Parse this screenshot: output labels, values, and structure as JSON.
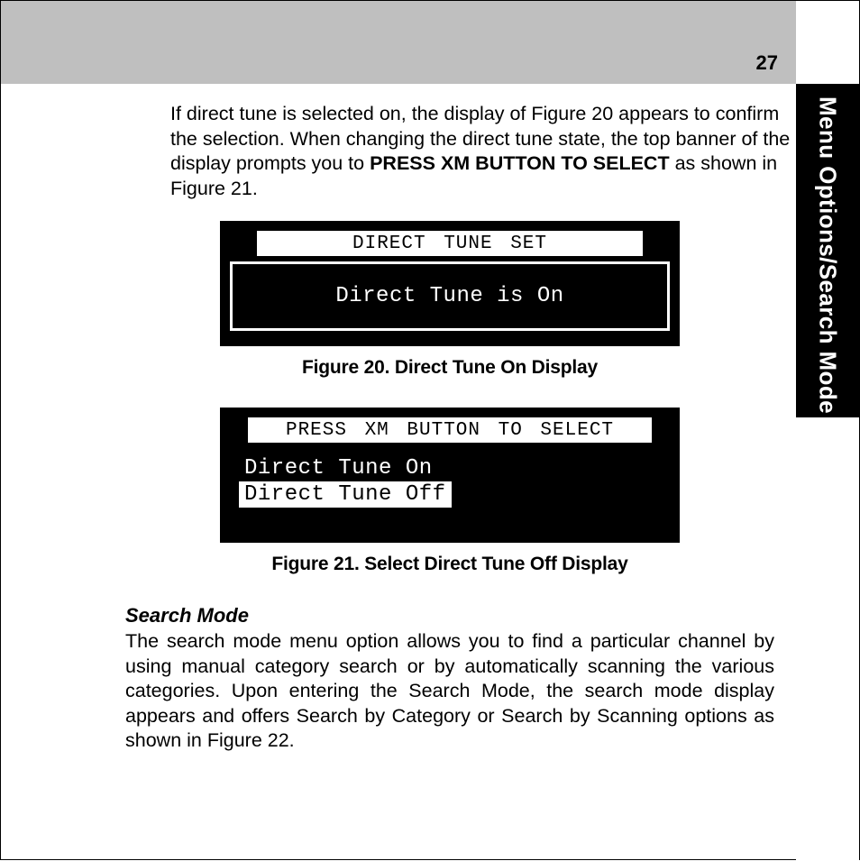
{
  "page_number": "27",
  "side_tab": "Menu Options/Search Mode",
  "intro": {
    "part1": "If direct tune is selected on, the display of Figure 20 appears to confirm the selection. When changing the direct tune state, the top banner of the display prompts you to ",
    "bold": "PRESS XM BUTTON TO SELECT",
    "part2": " as shown in Figure 21."
  },
  "figure20": {
    "banner": "DIRECT TUNE SET",
    "body": "Direct Tune is On",
    "caption": "Figure 20. Direct Tune On Display"
  },
  "figure21": {
    "banner": "PRESS XM BUTTON TO SELECT",
    "option_on": "Direct Tune On",
    "option_off": "Direct Tune Off",
    "caption": "Figure 21. Select Direct Tune Off Display"
  },
  "search_mode": {
    "heading": "Search Mode",
    "body": "The search mode menu option allows you to find a particular channel by  using manual category search or by automatically scanning the various categories. Upon entering the Search Mode, the search mode display appears and offers Search by Category or Search by Scanning options as shown in Figure 22."
  }
}
